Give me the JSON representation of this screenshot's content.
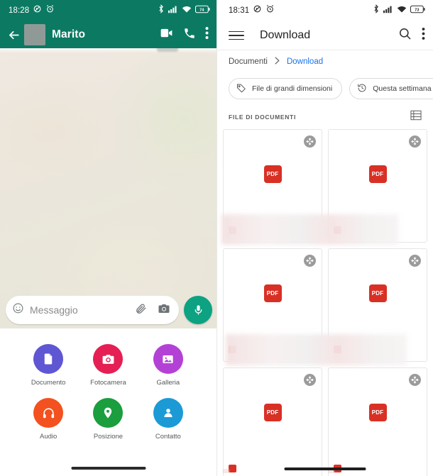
{
  "left_screen": {
    "app": "WhatsApp",
    "status_bar": {
      "time": "18:28",
      "icons": [
        "mute-icon",
        "alarm-icon",
        "bluetooth-icon",
        "signal-icon",
        "wifi-icon",
        "battery-icon"
      ],
      "battery_level": "74"
    },
    "app_bar": {
      "back_icon": "arrow-back-icon",
      "avatar": "redacted-avatar",
      "contact_name": "Marito",
      "actions": [
        "video-call-icon",
        "voice-call-icon",
        "overflow-menu-icon"
      ]
    },
    "composer": {
      "emoji_icon": "emoji-icon",
      "placeholder": "Messaggio",
      "attach_icon": "paperclip-icon",
      "camera_icon": "camera-icon",
      "mic_icon": "microphone-icon",
      "mic_color": "#0ca282"
    },
    "attachment_sheet": {
      "items": [
        {
          "label": "Documento",
          "icon": "document-icon",
          "color": "#5f56d3"
        },
        {
          "label": "Fotocamera",
          "icon": "camera-icon",
          "color": "#e51f53"
        },
        {
          "label": "Galleria",
          "icon": "gallery-icon",
          "color": "#b441d6"
        },
        {
          "label": "Audio",
          "icon": "headphones-icon",
          "color": "#f3511f"
        },
        {
          "label": "Posizione",
          "icon": "location-pin-icon",
          "color": "#1a9e3e"
        },
        {
          "label": "Contatto",
          "icon": "person-icon",
          "color": "#1b9ad6"
        }
      ]
    },
    "theme": {
      "header_green": "#0c7a63",
      "wallpaper": "#ece6dd"
    }
  },
  "right_screen": {
    "app": "File manager",
    "status_bar": {
      "time": "18:31",
      "icons": [
        "mute-icon",
        "alarm-icon",
        "bluetooth-icon",
        "signal-icon",
        "wifi-icon",
        "battery-icon"
      ],
      "battery_level": "73"
    },
    "app_bar": {
      "menu_icon": "hamburger-menu-icon",
      "title": "Download",
      "actions": [
        "search-icon",
        "overflow-menu-icon"
      ]
    },
    "breadcrumb": {
      "root": "Documenti",
      "separator_icon": "chevron-right-icon",
      "current": "Download",
      "current_color": "#1a73e8"
    },
    "filter_chips": [
      {
        "label": "File di grandi dimensioni",
        "icon": "tag-icon"
      },
      {
        "label": "Questa settimana",
        "icon": "history-clock-icon"
      }
    ],
    "section": {
      "label": "FILE DI DOCUMENTI",
      "view_toggle_icon": "list-view-icon"
    },
    "documents": [
      {
        "type": "PDF",
        "badge": "PDF",
        "expand_icon": "expand-fullscreen-icon",
        "name": ""
      },
      {
        "type": "PDF",
        "badge": "PDF",
        "expand_icon": "expand-fullscreen-icon",
        "name": ""
      },
      {
        "type": "PDF",
        "badge": "PDF",
        "expand_icon": "expand-fullscreen-icon",
        "name": ""
      },
      {
        "type": "PDF",
        "badge": "PDF",
        "expand_icon": "expand-fullscreen-icon",
        "name": ""
      },
      {
        "type": "PDF",
        "badge": "PDF",
        "expand_icon": "expand-fullscreen-icon",
        "name": ""
      },
      {
        "type": "PDF",
        "badge": "PDF",
        "expand_icon": "expand-fullscreen-icon",
        "name": ""
      }
    ],
    "theme": {
      "accent": "#1a73e8",
      "pdf_red": "#d93025"
    }
  }
}
